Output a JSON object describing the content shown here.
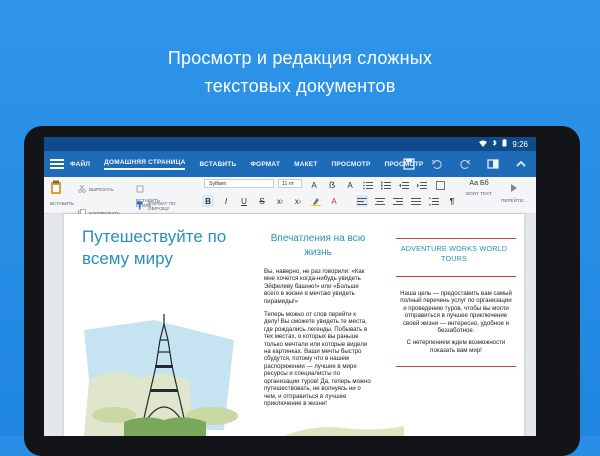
{
  "headline": {
    "line1": "Просмотр и редакция сложных",
    "line2": "текстовых документов"
  },
  "status": {
    "time": "9:26"
  },
  "tabs": [
    {
      "label": "ФАЙЛ"
    },
    {
      "label": "ДОМАШНЯЯ СТРАНИЦА"
    },
    {
      "label": "ВСТАВИТЬ"
    },
    {
      "label": "ФОРМАТ"
    },
    {
      "label": "МАКЕТ"
    },
    {
      "label": "ПРОСМОТР"
    },
    {
      "label": "ПРОСМОТР"
    }
  ],
  "ribbon": {
    "paste_label": "ВСТАВИТЬ",
    "cut_label": "ВЫРЕЗАТЬ",
    "copy_label": "КОПИРОВАТЬ",
    "paste_style_label": "ВСТАВИТЬ СТИЛЬ",
    "format_painter_label": "ФОРМАТ ПО ОБРАЗЦУ",
    "font_name": "Sylfaen",
    "font_size": "11 пт",
    "styles_preview": "Аа Бб",
    "body_text_label": "BODY TEXT",
    "more_label": "ПЕРЕЙТИ..."
  },
  "document": {
    "col1_title": "Путешествуйте по всему миру",
    "col2_title": "Впечатления на всю жизнь",
    "col2_paragraphs": [
      "Вы, наверно, не раз говорили: «Как мне хочется когда-нибудь увидеть Эйфелеву башню!» или «Больше всего в жизни я мечтаю увидеть пирамиды!»",
      "Теперь можно от слов перейти к делу! Вы сможете увидеть те места, где рождались легенды. Побывать в тех местах, о которых вы раньше только мечтали или которые видели на картинках. Ваши мечты быстро сбудутся, потому что в нашем распоряжении — лучшие в мире ресурсы и специалисты по организации туров! Да, теперь можно путешествовать, не волнуясь ни о чем, и отправиться в лучшее приключение в жизни!"
    ],
    "col3_title": "ADVENTURE WORKS WORLD TOURS",
    "col3_paragraphs": [
      "Наша цель — предоставить вам самый полный перечень услуг по организации и проведению туров, чтобы вы могли отправиться в лучшее приключение своей жизни — интересно, удобное и беззаботное.",
      "С нетерпением ждем возможности показать вам мир!"
    ]
  },
  "colors": {
    "background": "#2a8ee6",
    "appbar": "#1e6bb8",
    "statusbar": "#0f4a8a",
    "accent_text": "#2a8fb8",
    "rule": "#c3443c"
  }
}
